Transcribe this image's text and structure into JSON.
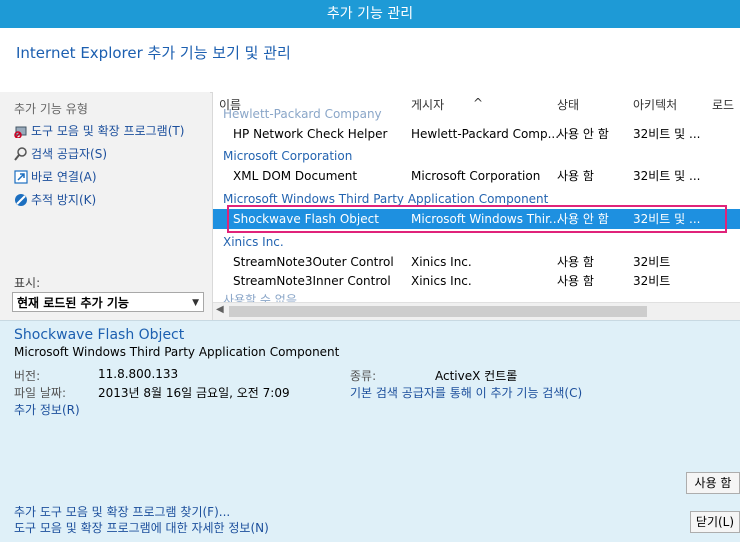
{
  "window": {
    "title": "추가 기능 관리"
  },
  "header": {
    "title": "Internet Explorer 추가 기능 보기 및 관리"
  },
  "sidebar": {
    "group_label": "추가 기능 유형",
    "items": [
      {
        "label": "도구 모음 및 확장 프로그램(T)",
        "icon": "toolbar-extensions-icon"
      },
      {
        "label": "검색 공급자(S)",
        "icon": "search-icon"
      },
      {
        "label": "바로 연결(A)",
        "icon": "accelerator-icon"
      },
      {
        "label": "추적 방지(K)",
        "icon": "tracking-protection-icon"
      }
    ],
    "show_label": "표시:",
    "show_value": "현재 로드된 추가 기능"
  },
  "list": {
    "columns": [
      "이름",
      "게시자",
      "상태",
      "아키텍처",
      "로드"
    ],
    "rows": [
      {
        "type": "group",
        "name": "Hewlett-Packard Company"
      },
      {
        "type": "item",
        "name": "HP Network Check Helper",
        "publisher": "Hewlett-Packard Comp...",
        "status": "사용 안 함",
        "arch": "32비트 및 ..."
      },
      {
        "type": "group",
        "name": "Microsoft Corporation"
      },
      {
        "type": "item",
        "name": "XML DOM Document",
        "publisher": "Microsoft Corporation",
        "status": "사용 함",
        "arch": "32비트 및 ..."
      },
      {
        "type": "group",
        "name": "Microsoft Windows Third Party Application Component"
      },
      {
        "type": "item",
        "name": "Shockwave Flash Object",
        "publisher": "Microsoft Windows Thir...",
        "status": "사용 안 함",
        "arch": "32비트 및 ...",
        "selected": true
      },
      {
        "type": "group",
        "name": "Xinics Inc."
      },
      {
        "type": "item",
        "name": "StreamNote3Outer Control",
        "publisher": "Xinics Inc.",
        "status": "사용 함",
        "arch": "32비트"
      },
      {
        "type": "item",
        "name": "StreamNote3Inner Control",
        "publisher": "Xinics Inc.",
        "status": "사용 함",
        "arch": "32비트"
      },
      {
        "type": "group",
        "name": "사용할 수 없음"
      }
    ]
  },
  "details": {
    "title": "Shockwave Flash Object",
    "subtitle": "Microsoft Windows Third Party Application Component",
    "version_label": "버전:",
    "version_value": "11.8.800.133",
    "date_label": "파일 날짜:",
    "date_value": "2013년 8월 16일 금요일, 오전 7:09",
    "more_info": "추가 정보(R)",
    "type_label": "종류:",
    "type_value": "ActiveX 컨트롤",
    "search_link": "기본 검색 공급자를 통해 이 추가 기능 검색(C)",
    "find_more_link": "추가 도구 모음 및 확장 프로그램 찾기(F)...",
    "learn_more_link": "도구 모음 및 확장 프로그램에 대한 자세한 정보(N)",
    "disable_button": "사용 함",
    "close_button": "닫기(L)"
  }
}
